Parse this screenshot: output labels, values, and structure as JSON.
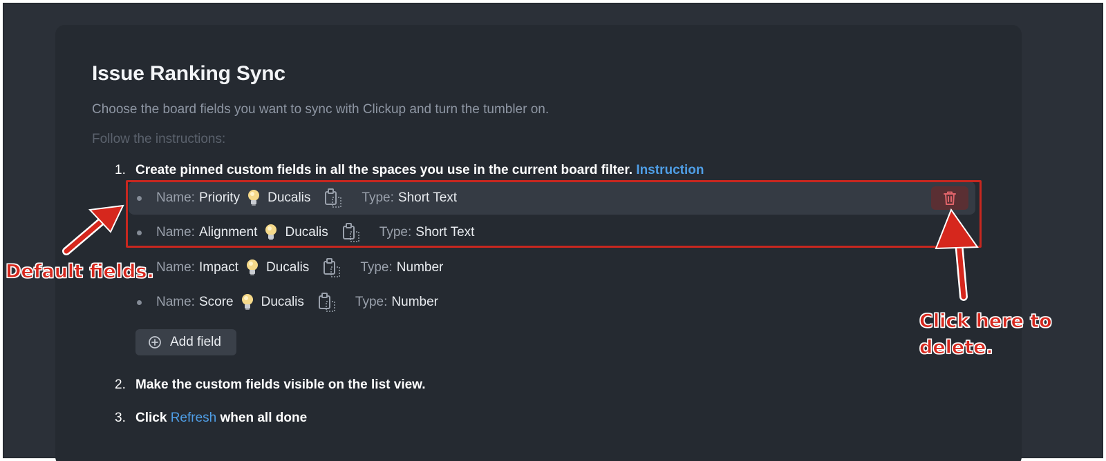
{
  "header": {
    "title": "Issue Ranking Sync",
    "subtitle": "Choose the board fields you want to sync with Clickup and turn the tumbler on.",
    "follow": "Follow the instructions:"
  },
  "steps": [
    {
      "num": "1.",
      "text": "Create pinned custom fields in all the spaces you use in the current board filter.",
      "link": "Instruction"
    },
    {
      "num": "2.",
      "text": "Make the custom fields visible on the list view."
    },
    {
      "num": "3.",
      "pre": "Click",
      "link": "Refresh",
      "post": "when all done"
    }
  ],
  "fields": [
    {
      "name_label": "Name:",
      "name": "Priority",
      "source": "Ducalis",
      "type_label": "Type:",
      "type": "Short Text"
    },
    {
      "name_label": "Name:",
      "name": "Alignment",
      "source": "Ducalis",
      "type_label": "Type:",
      "type": "Short Text"
    },
    {
      "name_label": "Name:",
      "name": "Impact",
      "source": "Ducalis",
      "type_label": "Type:",
      "type": "Number"
    },
    {
      "name_label": "Name:",
      "name": "Score",
      "source": "Ducalis",
      "type_label": "Type:",
      "type": "Number"
    }
  ],
  "add_field_label": "Add field",
  "annotations": {
    "default_fields": "Default fields.",
    "click_delete_line1": "Click here to",
    "click_delete_line2": "delete."
  },
  "colors": {
    "annotation": "#d6271d",
    "link": "#4f9ee6",
    "delete_bg": "#5a2f33"
  },
  "icons": [
    "bulb-icon",
    "copy-icon",
    "trash-icon",
    "plus-circle-icon",
    "arrow-icon"
  ]
}
